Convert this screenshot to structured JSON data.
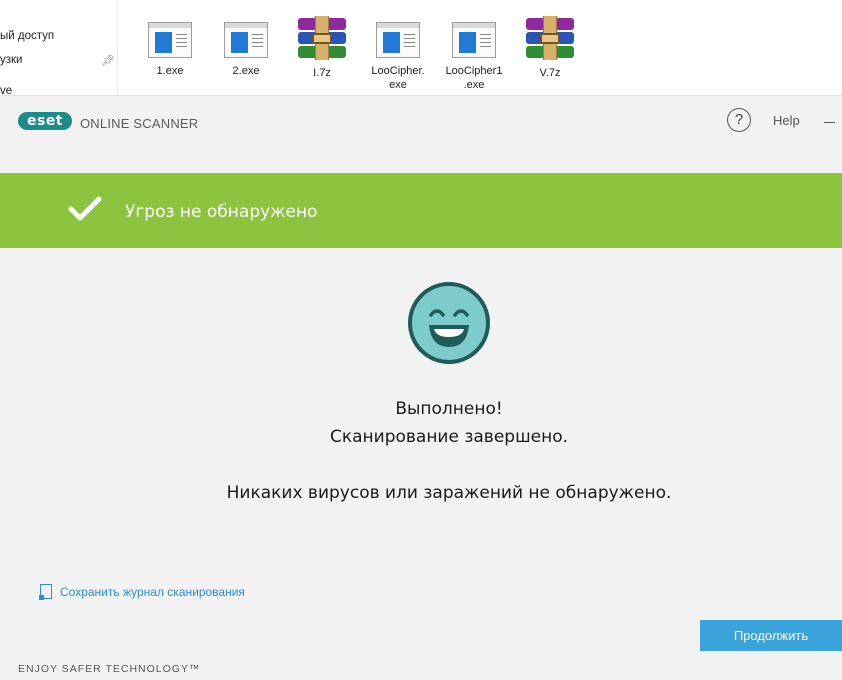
{
  "explorer": {
    "nav_items": [
      "ый доступ",
      "узки",
      "ve"
    ],
    "files": [
      {
        "name": "1.exe",
        "type": "exe"
      },
      {
        "name": "2.exe",
        "type": "exe"
      },
      {
        "name": "I.7z",
        "type": "archive"
      },
      {
        "name": "LooCipher.\nexe",
        "type": "exe"
      },
      {
        "name": "LooCipher1\n.exe",
        "type": "exe"
      },
      {
        "name": "V.7z",
        "type": "archive"
      }
    ]
  },
  "header": {
    "logo": "eset",
    "product": "ONLINE SCANNER",
    "help_symbol": "?",
    "help_label": "Help"
  },
  "banner": {
    "text": "Угроз не обнаружено",
    "color": "#8dc43f"
  },
  "result": {
    "line1": "Выполнено!",
    "line2": "Сканирование завершено.",
    "line3": "Никаких вирусов или заражений не обнаружено."
  },
  "actions": {
    "save_log": "Сохранить журнал сканирования",
    "continue": "Продолжить"
  },
  "footer": "ENJOY SAFER TECHNOLOGY™",
  "colors": {
    "accent": "#3aa3dc",
    "link": "#2a8fd4",
    "logo": "#1e8a8a",
    "smiley_face": "#7ecbcb",
    "smiley_outline": "#1e5b5b"
  }
}
